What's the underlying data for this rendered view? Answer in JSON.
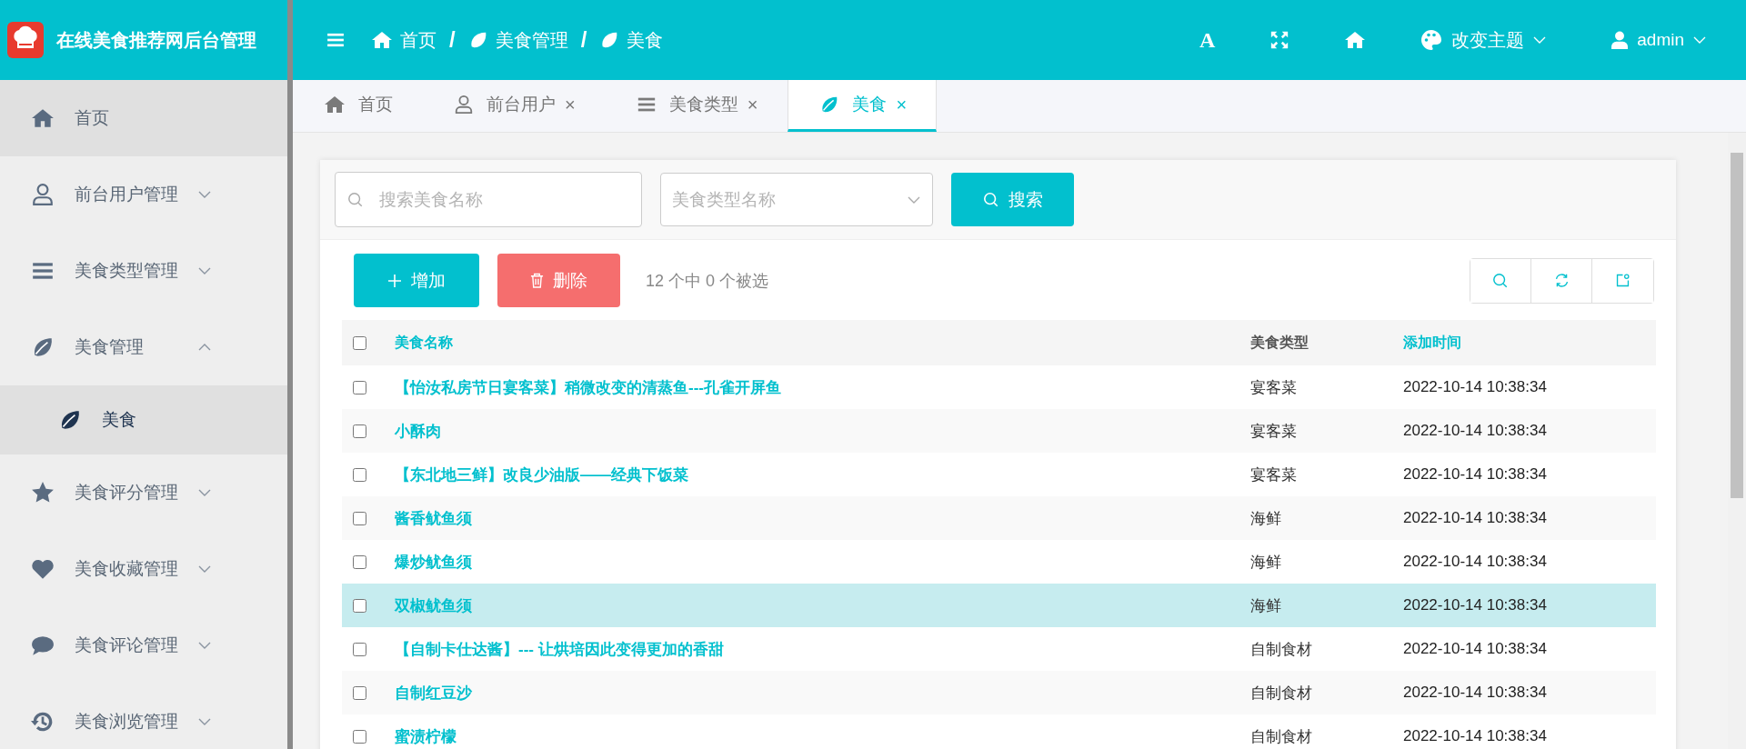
{
  "app": {
    "title": "在线美食推荐网后台管理"
  },
  "header": {
    "breadcrumb": [
      {
        "label": "首页"
      },
      {
        "label": "美食管理",
        "separator": "/"
      },
      {
        "label": "美食",
        "separator": "/"
      }
    ],
    "font_button": "A",
    "theme_menu": "改变主题",
    "user": "admin"
  },
  "sidebar": {
    "items": [
      {
        "label": "首页",
        "kind": "link",
        "selected": true
      },
      {
        "label": "前台用户管理",
        "kind": "submenu",
        "expanded": false,
        "selected": false
      },
      {
        "label": "美食类型管理",
        "kind": "submenu",
        "expanded": false,
        "selected": false
      },
      {
        "label": "美食管理",
        "kind": "submenu",
        "expanded": true,
        "selected": false,
        "children": [
          {
            "label": "美食",
            "selected": true
          }
        ]
      },
      {
        "label": "美食评分管理",
        "kind": "submenu",
        "expanded": false,
        "selected": false
      },
      {
        "label": "美食收藏管理",
        "kind": "submenu",
        "expanded": false,
        "selected": false
      },
      {
        "label": "美食评论管理",
        "kind": "submenu",
        "expanded": false,
        "selected": false
      },
      {
        "label": "美食浏览管理",
        "kind": "submenu",
        "expanded": false,
        "selected": false
      }
    ]
  },
  "tabs": [
    {
      "label": "首页",
      "selected": false
    },
    {
      "label": "前台用户",
      "close": "×",
      "selected": false
    },
    {
      "label": "美食类型",
      "close": "×",
      "selected": false
    },
    {
      "label": "美食",
      "close": "×",
      "selected": true
    }
  ],
  "search": {
    "name_placeholder": "搜索美食名称",
    "type_placeholder": "美食类型名称",
    "button": "搜索"
  },
  "toolbar": {
    "add": "增加",
    "delete": "删除",
    "selection_info": "12 个中 0 个被选"
  },
  "table": {
    "header_checked": false,
    "columns": [
      {
        "label": "美食名称",
        "sortable": true
      },
      {
        "label": "美食类型",
        "sortable": false
      },
      {
        "label": "添加时间",
        "sortable": true
      }
    ],
    "rows": [
      {
        "checked": false,
        "selected": false,
        "name": "【怡汝私房节日宴客菜】稍微改变的清蒸鱼---孔雀开屏鱼",
        "type": "宴客菜",
        "time": "2022-10-14 10:38:34"
      },
      {
        "checked": false,
        "selected": false,
        "name": "小酥肉",
        "type": "宴客菜",
        "time": "2022-10-14 10:38:34"
      },
      {
        "checked": false,
        "selected": false,
        "name": "【东北地三鲜】改良少油版——经典下饭菜",
        "type": "宴客菜",
        "time": "2022-10-14 10:38:34"
      },
      {
        "checked": false,
        "selected": false,
        "name": "酱香鱿鱼须",
        "type": "海鲜",
        "time": "2022-10-14 10:38:34"
      },
      {
        "checked": false,
        "selected": false,
        "name": "爆炒鱿鱼须",
        "type": "海鲜",
        "time": "2022-10-14 10:38:34"
      },
      {
        "checked": false,
        "selected": true,
        "name": "双椒鱿鱼须",
        "type": "海鲜",
        "time": "2022-10-14 10:38:34"
      },
      {
        "checked": false,
        "selected": false,
        "name": "【自制卡仕达酱】--- 让烘培因此变得更加的香甜",
        "type": "自制食材",
        "time": "2022-10-14 10:38:34"
      },
      {
        "checked": false,
        "selected": false,
        "name": "自制红豆沙",
        "type": "自制食材",
        "time": "2022-10-14 10:38:34"
      },
      {
        "checked": false,
        "selected": false,
        "name": "蜜渍柠檬",
        "type": "自制食材",
        "time": "2022-10-14 10:38:34"
      }
    ]
  }
}
